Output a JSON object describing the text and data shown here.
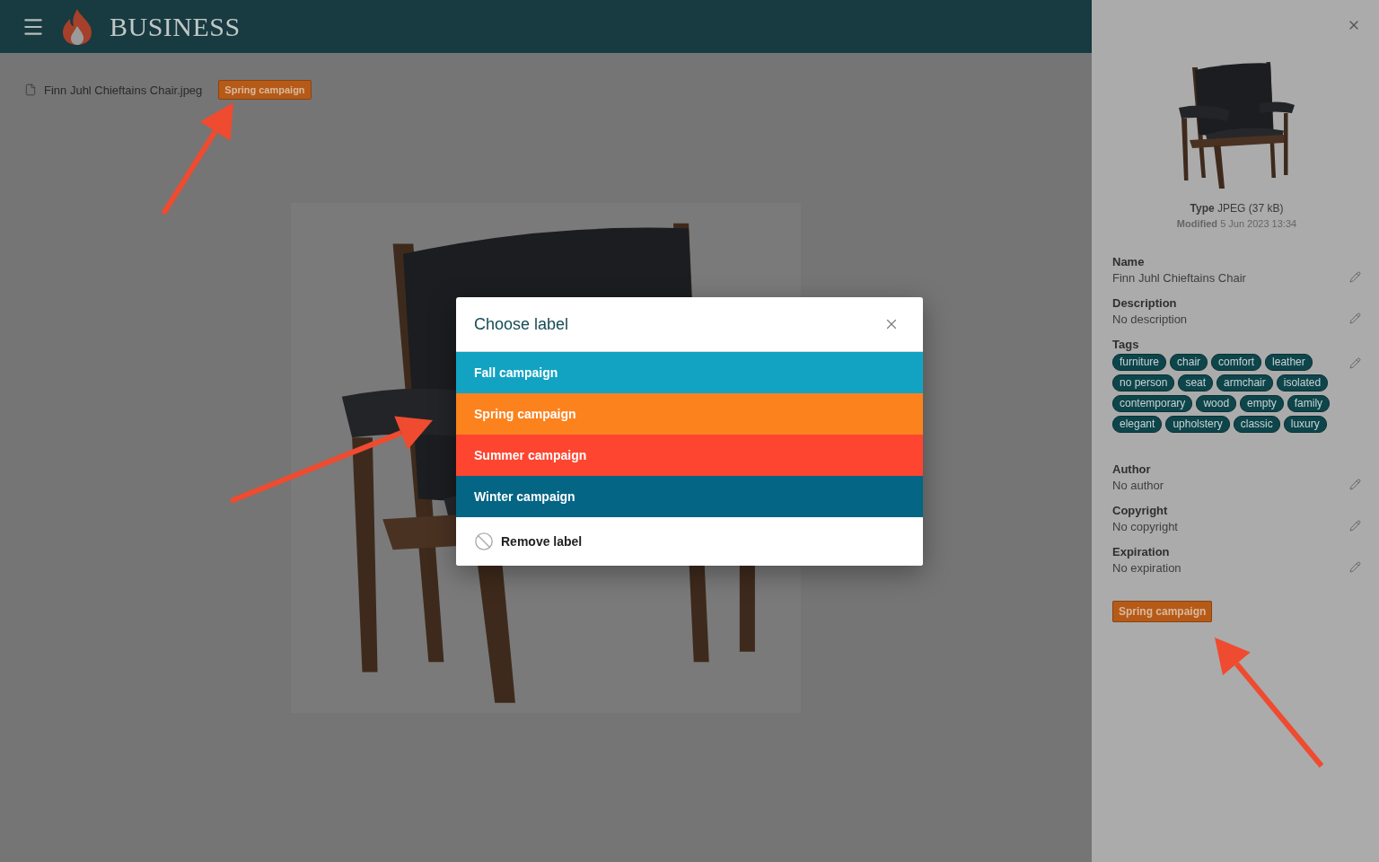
{
  "header": {
    "brand": "BUSINESS"
  },
  "file": {
    "name": "Finn Juhl Chieftains Chair.jpeg",
    "label": "Spring campaign"
  },
  "dialog": {
    "title": "Choose label",
    "labels": [
      {
        "name": "Fall campaign",
        "color": "#12a3c2"
      },
      {
        "name": "Spring campaign",
        "color": "#fc821e"
      },
      {
        "name": "Summer campaign",
        "color": "#fe4530"
      },
      {
        "name": "Winter campaign",
        "color": "#046585"
      }
    ],
    "remove": "Remove label"
  },
  "sidebar": {
    "type_label": "Type",
    "type_value": "JPEG (37 kB)",
    "modified_label": "Modified",
    "modified_value": "5 Jun 2023 13:34",
    "fields": [
      {
        "kind": "text",
        "label": "Name",
        "value": "Finn Juhl Chieftains Chair"
      },
      {
        "kind": "text",
        "label": "Description",
        "value": "No description"
      },
      {
        "kind": "tags",
        "label": "Tags",
        "tags": [
          "furniture",
          "chair",
          "comfort",
          "leather",
          "no person",
          "seat",
          "armchair",
          "isolated",
          "contemporary",
          "wood",
          "empty",
          "family",
          "elegant",
          "upholstery",
          "classic",
          "luxury"
        ]
      },
      {
        "kind": "text",
        "label": "Author",
        "value": "No author"
      },
      {
        "kind": "text",
        "label": "Copyright",
        "value": "No copyright"
      },
      {
        "kind": "text",
        "label": "Expiration",
        "value": "No expiration"
      }
    ],
    "label": "Spring campaign"
  }
}
